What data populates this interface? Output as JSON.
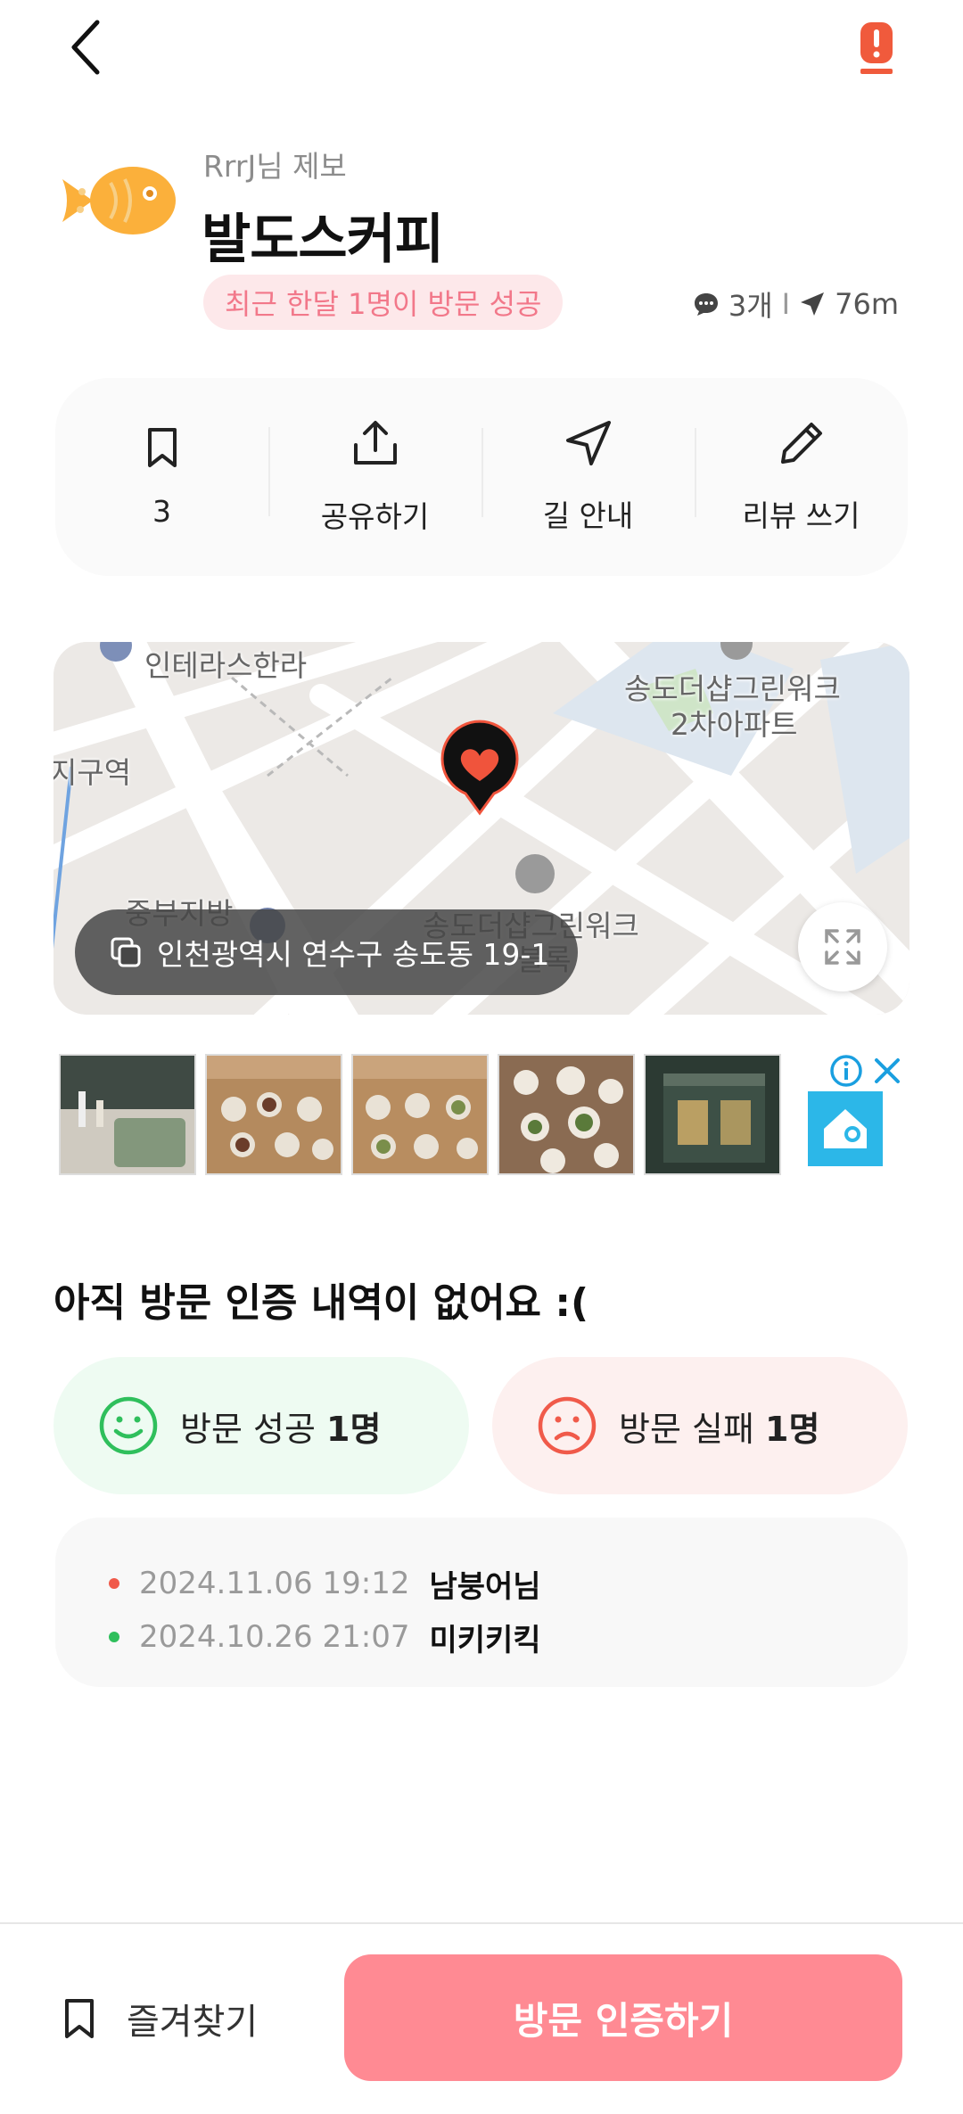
{
  "header": {
    "reporter": "RrrJ님 제보",
    "title": "발도스커피",
    "visit_badge": "최근 한달 1명이 방문 성공",
    "comments": "3개",
    "separator": "I",
    "distance": "76m"
  },
  "actions": [
    {
      "icon": "bookmark-icon",
      "label": "3"
    },
    {
      "icon": "share-icon",
      "label": "공유하기"
    },
    {
      "icon": "navigate-icon",
      "label": "길 안내"
    },
    {
      "icon": "pencil-icon",
      "label": "리뷰 쓰기"
    }
  ],
  "map": {
    "labels": [
      "인테라스한라",
      "송도더샵그린워크",
      "2차아파트",
      "지구역",
      "중부지방",
      "송도더샵그린워크",
      "블록"
    ],
    "address": "인천광역시 연수구 송도동 19-1"
  },
  "ad": {
    "images": 5,
    "info_icon": "info-icon",
    "close_icon": "close-icon"
  },
  "visits": {
    "empty_title": "아직 방문 인증 내역이 없어요 :(",
    "success_label": "방문 성공",
    "success_count": "1명",
    "fail_label": "방문 실패",
    "fail_count": "1명",
    "history": [
      {
        "date": "2024.11.06 19:12",
        "name": "남붕어님",
        "color": "#f05a4a"
      },
      {
        "date": "2024.10.26 21:07",
        "name": "미키키킥",
        "color": "#2fbf5c"
      }
    ]
  },
  "bottom": {
    "favorite_label": "즐겨찾기",
    "cta_label": "방문 인증하기"
  },
  "colors": {
    "accent": "#ff8a93",
    "badge_bg": "#fde8ea",
    "badge_text": "#f2788a",
    "report": "#f05a3c",
    "success": "#2fbf5c",
    "fail": "#f05a4a"
  }
}
